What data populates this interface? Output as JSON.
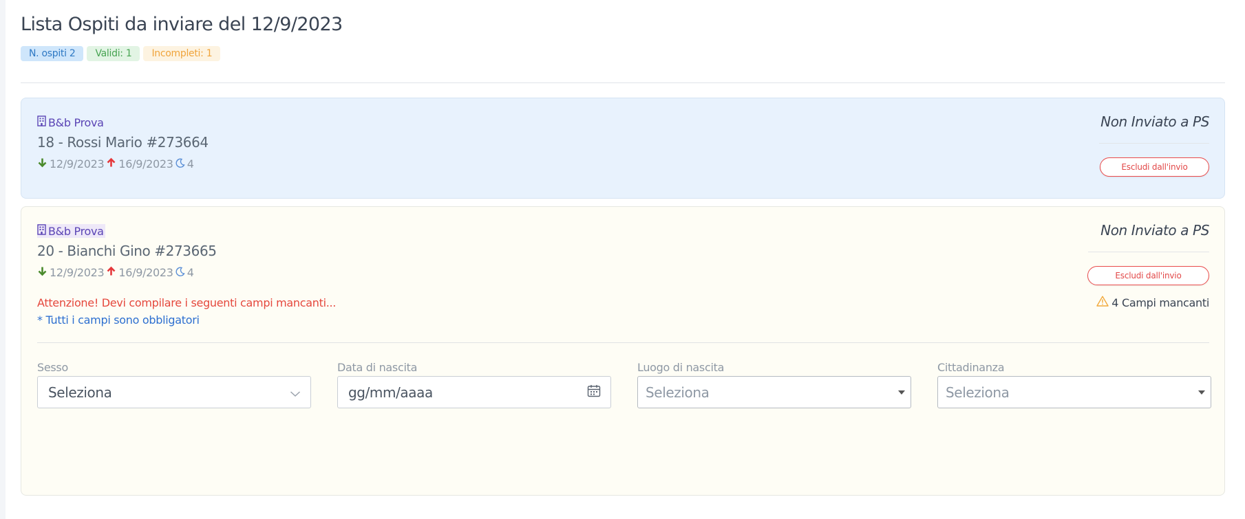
{
  "header": {
    "title": "Lista Ospiti da inviare del 12/9/2023",
    "badges": {
      "ospiti": "N. ospiti 2",
      "validi": "Validi: 1",
      "incompleti": "Incompleti: 1"
    }
  },
  "guests": [
    {
      "property": "B&b Prova",
      "name": "18 - Rossi Mario #273664",
      "checkin": "12/9/2023",
      "checkout": "16/9/2023",
      "nights": "4",
      "status": "Non Inviato a PS",
      "exclude_label": "Escludi dall'invio"
    },
    {
      "property": "B&b Prova",
      "name": "20 - Bianchi Gino #273665",
      "checkin": "12/9/2023",
      "checkout": "16/9/2023",
      "nights": "4",
      "status": "Non Inviato a PS",
      "exclude_label": "Escludi dall'invio",
      "warning": "Attenzione! Devi compilare i seguenti campi mancanti...",
      "required_note": "* Tutti i campi sono obbligatori",
      "missing_count": "4 Campi mancanti",
      "fields": {
        "sesso": {
          "label": "Sesso",
          "value": "Seleziona"
        },
        "data_nascita": {
          "label": "Data di nascita",
          "value": "gg/mm/aaaa"
        },
        "luogo_nascita": {
          "label": "Luogo di nascita",
          "value": "Seleziona"
        },
        "cittadinanza": {
          "label": "Cittadinanza",
          "value": "Seleziona"
        }
      }
    }
  ],
  "colors": {
    "checkin_arrow": "#4a8a2c",
    "checkout_arrow": "#e5383b",
    "moon": "#5b8fd6",
    "property": "#5b45b5",
    "warning_icon": "#f2a93b"
  }
}
